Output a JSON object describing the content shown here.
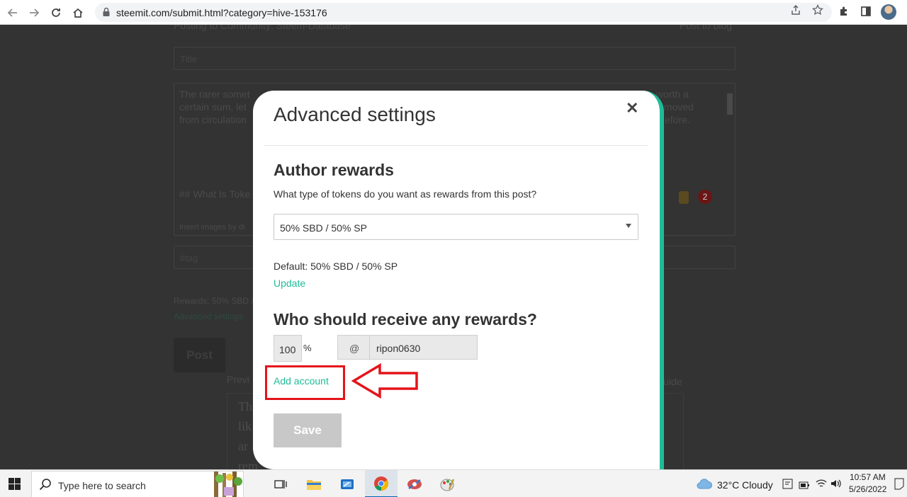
{
  "browser": {
    "url": "steemit.com/submit.html?category=hive-153176"
  },
  "background_page": {
    "posting_to": "Posting to Community: Steem-Database",
    "post_to_blog": "Post to blog",
    "title_placeholder": "Title",
    "body_line1_left": "The rarer somet",
    "body_line1_right": "worth a",
    "body_line2_left": "certain sum,  let",
    "body_line2_right": "emoved",
    "body_line3_left": "from circulation",
    "body_line3_right": "efore.",
    "body_line4": "## What Is Toke",
    "insert_images": "Insert images by dr",
    "tag_placeholder": "#tag",
    "rewards_line": "Rewards: 50% SBD /",
    "advanced_settings_link": "Advanced settings",
    "post_button": "Post",
    "preview_label": "Previ",
    "guide_label": "uide",
    "preview_text": [
      "Th",
      "lik",
      "ar",
      "rem"
    ],
    "notif_count": "2"
  },
  "modal": {
    "title": "Advanced settings",
    "author_rewards": {
      "heading": "Author rewards",
      "question": "What type of tokens do you want as rewards from this post?",
      "selected": "50% SBD / 50% SP",
      "default_text": "Default: 50% SBD / 50% SP",
      "update_link": "Update"
    },
    "beneficiaries": {
      "heading": "Who should receive any rewards?",
      "percent": "100",
      "percent_sign": "%",
      "at_sign": "@",
      "account": "ripon0630",
      "add_account_link": "Add account"
    },
    "save_label": "Save"
  },
  "taskbar": {
    "search_placeholder": "Type here to search",
    "weather": "32°C  Cloudy",
    "time": "10:57 AM",
    "date": "5/26/2022"
  },
  "colors": {
    "accent": "#1fbc98",
    "annotation": "#e4141b",
    "save_disabled": "#c8c8c8"
  }
}
